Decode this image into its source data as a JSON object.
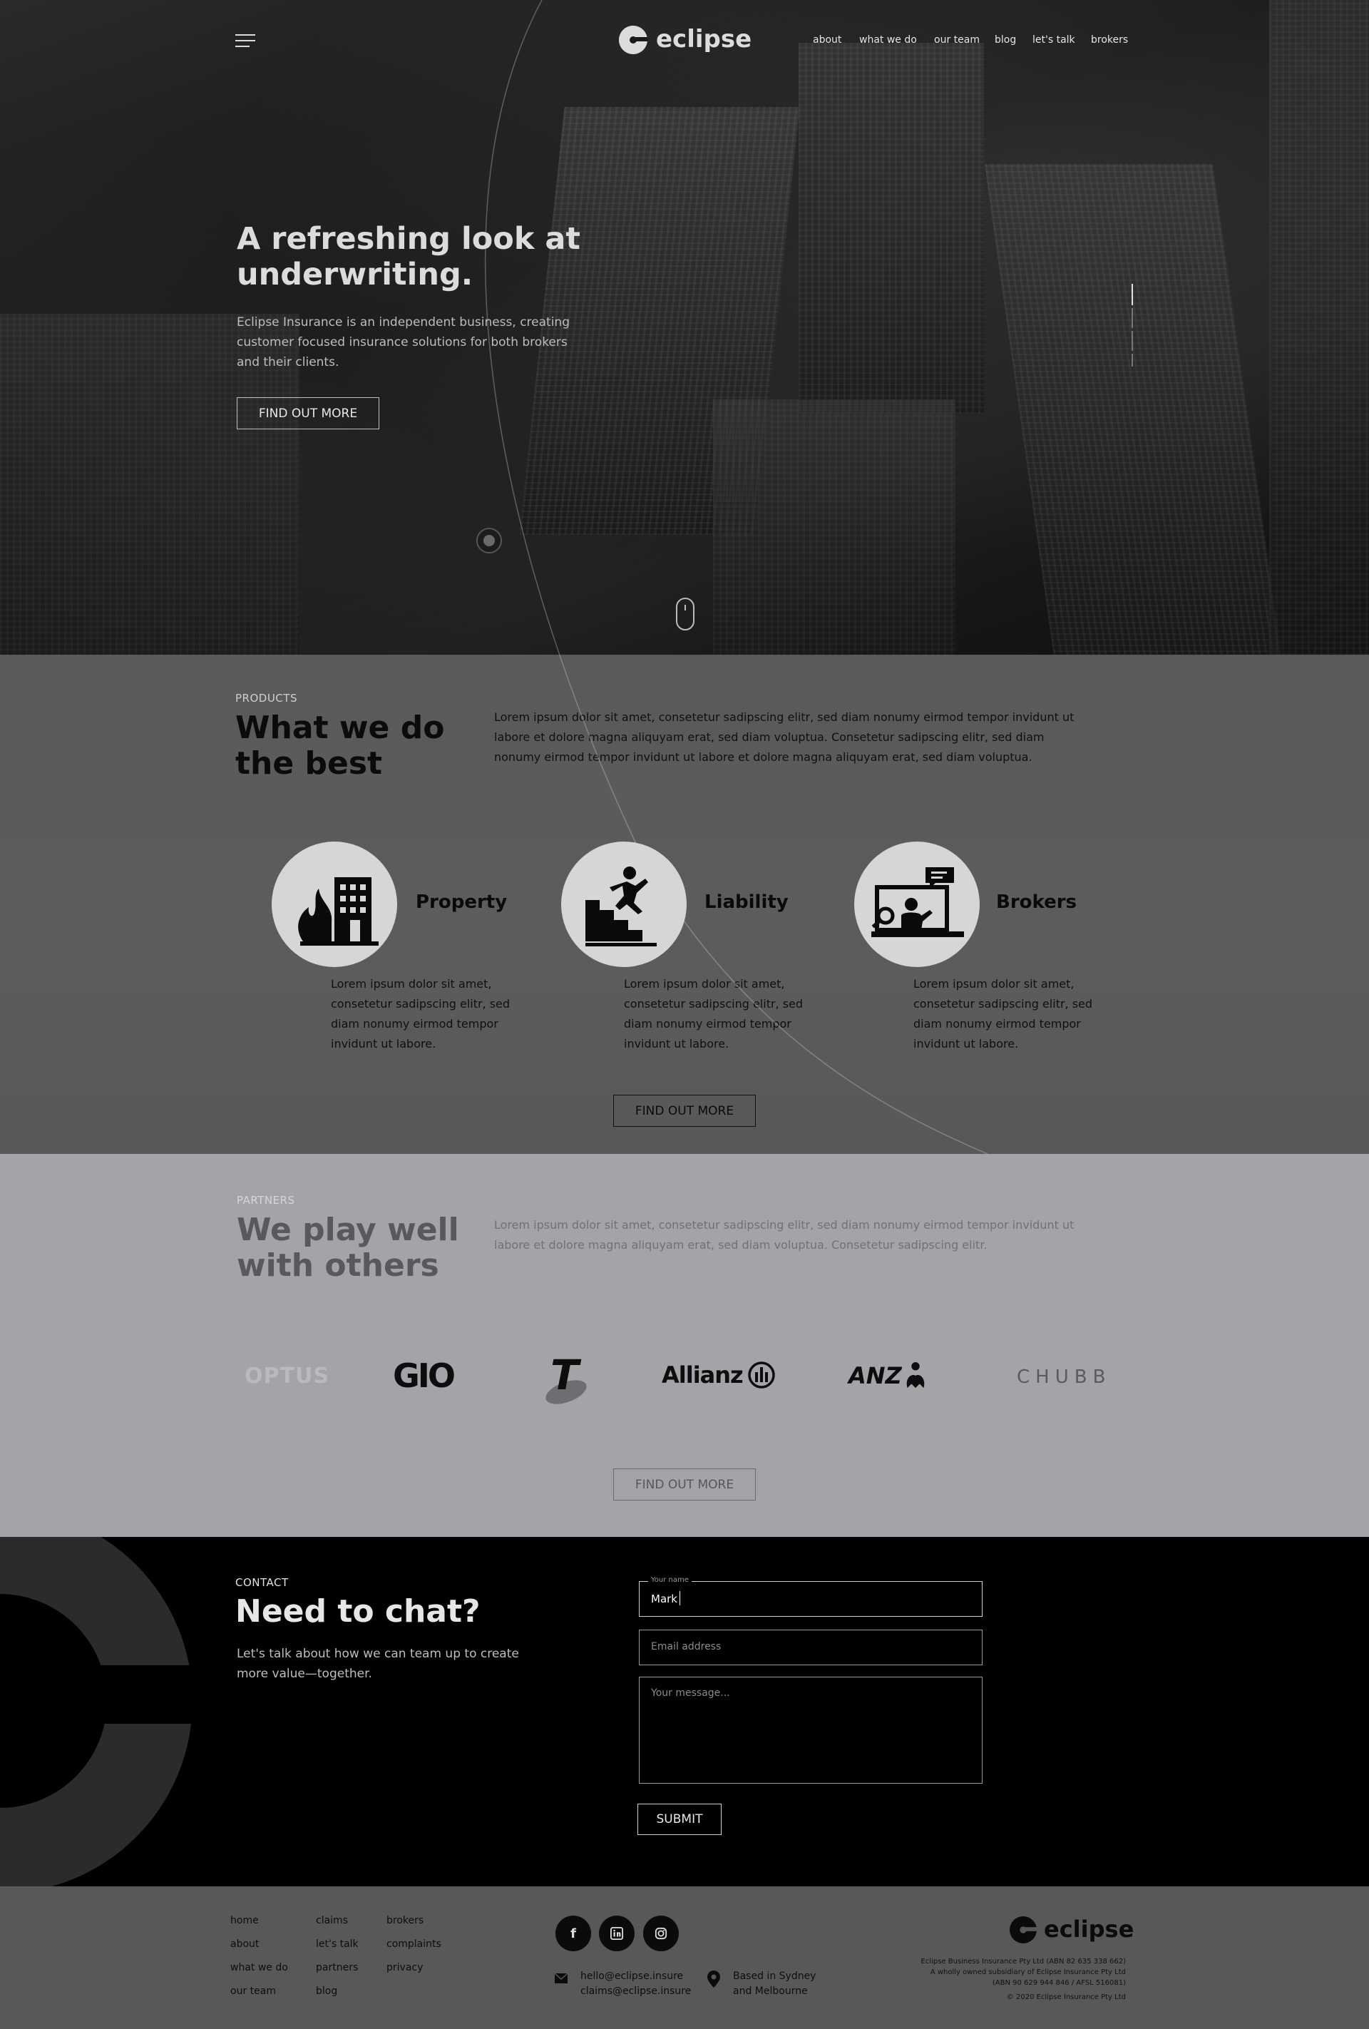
{
  "brand": {
    "name": "eclipse"
  },
  "nav": {
    "items": [
      "about",
      "what we do",
      "our team",
      "blog",
      "let's talk",
      "brokers"
    ]
  },
  "hero": {
    "title": "A refreshing look at underwriting.",
    "subtitle": "Eclipse Insurance is an independent business, creating customer focused insurance solutions for both brokers and their clients.",
    "cta": "FIND OUT MORE"
  },
  "products": {
    "eyebrow": "PRODUCTS",
    "title": "What we do the best",
    "body": "Lorem ipsum dolor sit amet, consetetur sadipscing elitr, sed diam nonumy eirmod tempor invidunt ut labore et dolore magna aliquyam erat, sed diam voluptua. Consetetur sadipscing elitr, sed diam nonumy eirmod tempor invidunt ut labore et dolore magna aliquyam erat, sed diam voluptua.",
    "items": [
      {
        "name": "Property",
        "icon": "burning-building-icon",
        "desc": "Lorem ipsum dolor sit amet, consetetur sadipscing elitr, sed diam nonumy eirmod tempor invidunt ut labore."
      },
      {
        "name": "Liability",
        "icon": "falling-person-stairs-icon",
        "desc": "Lorem ipsum dolor sit amet, consetetur sadipscing elitr, sed diam nonumy eirmod tempor invidunt ut labore."
      },
      {
        "name": "Brokers",
        "icon": "presenter-screen-icon",
        "desc": "Lorem ipsum dolor sit amet, consetetur sadipscing elitr, sed diam nonumy eirmod tempor invidunt ut labore."
      }
    ],
    "cta": "FIND OUT MORE"
  },
  "partners": {
    "eyebrow": "PARTNERS",
    "title": "We play well with others",
    "body": "Lorem ipsum dolor sit amet, consetetur sadipscing elitr, sed diam nonumy eirmod tempor invidunt ut labore et dolore magna aliquyam erat, sed diam voluptua. Consetetur sadipscing elitr.",
    "logos": [
      "OPTUS",
      "GIO",
      "T",
      "Allianz",
      "ANZ",
      "CHUBB"
    ],
    "cta": "FIND OUT MORE"
  },
  "contact": {
    "eyebrow": "CONTACT",
    "title": "Need to chat?",
    "body": "Let's talk about how we can team up to create more value—together.",
    "name_label": "Your name",
    "name_value": "Mark",
    "email_placeholder": "Email address",
    "message_placeholder": "Your message...",
    "submit": "SUBMIT"
  },
  "footer": {
    "col1": [
      "home",
      "about",
      "what we do",
      "our team"
    ],
    "col2": [
      "claims",
      "let's talk",
      "partners",
      "blog"
    ],
    "col3": [
      "brokers",
      "complaints",
      "privacy"
    ],
    "social": [
      "facebook-icon",
      "linkedin-icon",
      "instagram-icon"
    ],
    "email1": "hello@eclipse.insure",
    "email2": "claims@eclipse.insure",
    "location1": "Based in Sydney",
    "location2": "and Melbourne",
    "legal1": "Eclipse Business Insurance Pty Ltd (ABN 82 635 338 662)",
    "legal2": "A wholly owned subsidiary of Eclipse Insurance Pty Ltd",
    "legal3": "(ABN 90 629 944 846 / AFSL 516081)",
    "copyright": "© 2020 Eclipse Insurance Pty Ltd"
  },
  "colors": {
    "products_bg": "#5a5a5b",
    "partners_bg": "#a3a4a8",
    "contact_bg": "#000000",
    "footer_bg": "#58585a"
  }
}
